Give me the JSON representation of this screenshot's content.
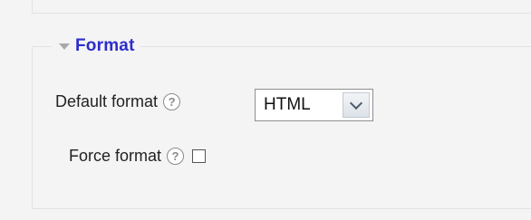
{
  "section": {
    "title": "Format",
    "expanded": true
  },
  "fields": {
    "default_format": {
      "label": "Default format",
      "help_icon": "help-icon",
      "selected_value": "HTML"
    },
    "force_format": {
      "label": "Force format",
      "help_icon": "help-icon",
      "checked": false
    }
  },
  "colors": {
    "legend_text": "#2d2dcc",
    "background": "#f4f4f4",
    "border": "#e2e2e2"
  }
}
